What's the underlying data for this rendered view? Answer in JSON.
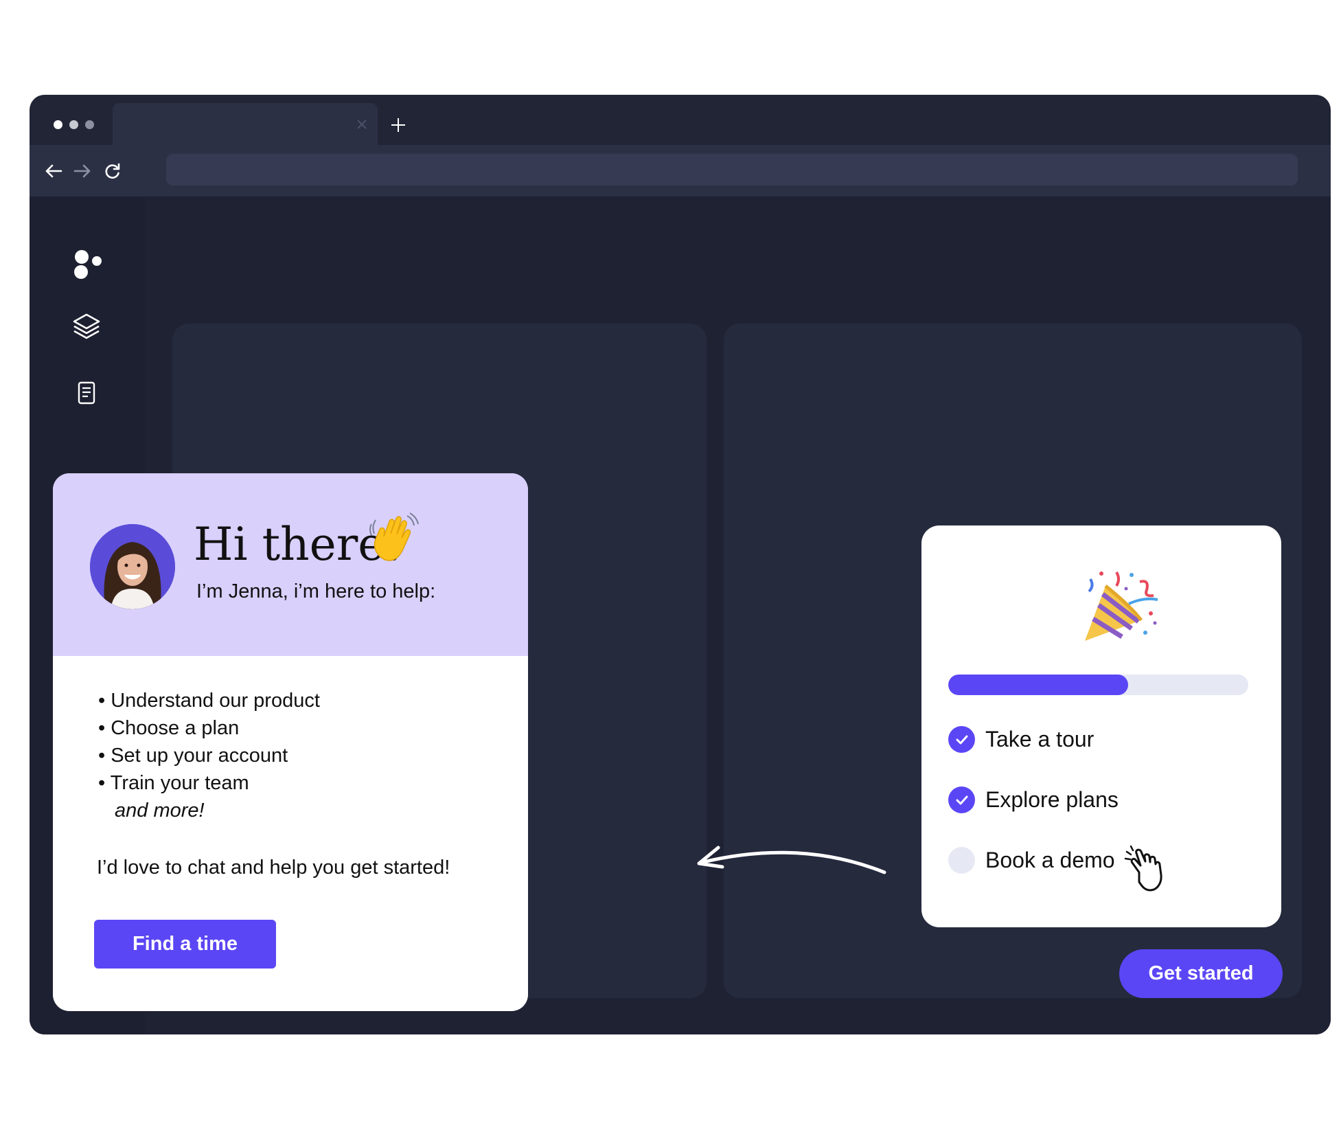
{
  "browser": {
    "window_dots": [
      "#ffffff",
      "#c7c9d1",
      "#8c90a0"
    ],
    "tab_title": "",
    "url": ""
  },
  "sidebar": {
    "items": [
      {
        "icon": "logo-dots-icon"
      },
      {
        "icon": "layers-icon"
      },
      {
        "icon": "document-icon"
      }
    ]
  },
  "chat_card": {
    "greeting": "Hi there!",
    "greeting_emoji": "waving-hand-icon",
    "subtitle": "I’m Jenna, i’m here to help:",
    "bullets": [
      "• Understand our product",
      "• Choose a plan",
      "• Set up your account",
      "• Train your team"
    ],
    "more": "and more!",
    "cta_text": "I’d love to chat and help you get started!",
    "button_label": "Find a time"
  },
  "checklist": {
    "emoji": "party-popper-icon",
    "progress": 0.6,
    "tasks": [
      {
        "label": "Take a tour",
        "done": true
      },
      {
        "label": "Explore plans",
        "done": true
      },
      {
        "label": "Book a demo",
        "done": false
      }
    ]
  },
  "get_started_label": "Get started",
  "colors": {
    "accent": "#5b46f5",
    "header_bg": "#d9d0fc",
    "window_bg": "#212536"
  }
}
